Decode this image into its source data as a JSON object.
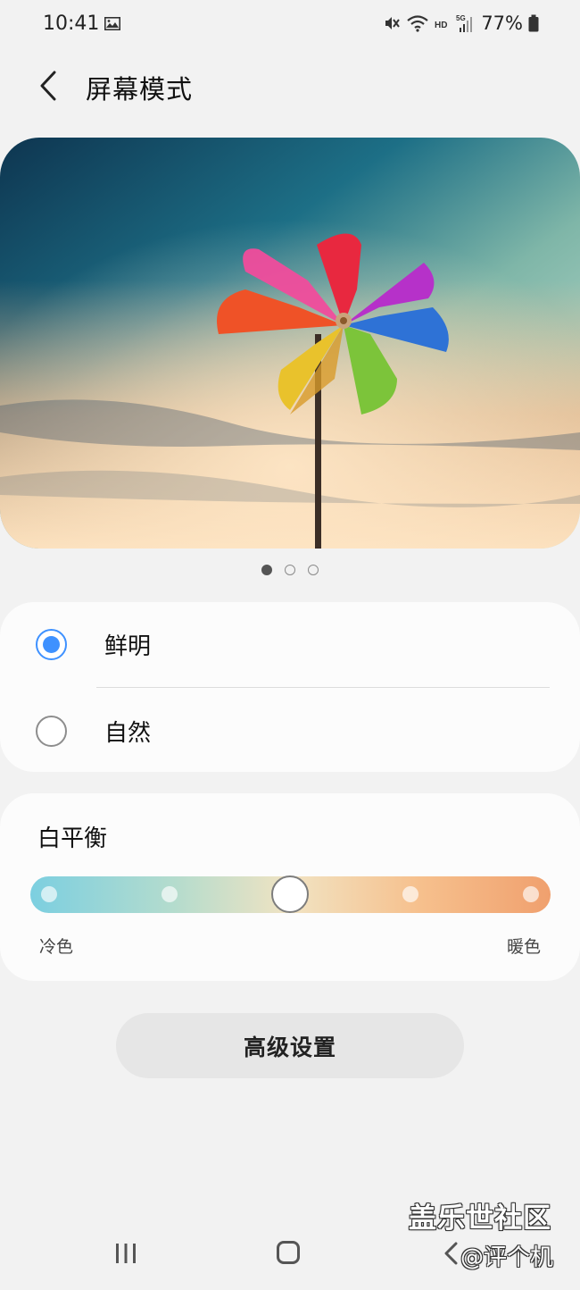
{
  "status_bar": {
    "time": "10:41",
    "battery_percent": "77%",
    "icons": [
      "gallery-icon",
      "mute-vibrate-icon",
      "wifi-icon",
      "hd-icon",
      "5g-signal-icon",
      "battery-icon"
    ]
  },
  "header": {
    "title": "屏幕模式",
    "back_icon": "chevron-left-icon"
  },
  "preview": {
    "image_subject": "pinwheel",
    "page_count": 3,
    "active_page": 1
  },
  "screen_mode": {
    "options": [
      {
        "label": "鲜明",
        "selected": true
      },
      {
        "label": "自然",
        "selected": false
      }
    ],
    "accent_color": "#3e91ff"
  },
  "white_balance": {
    "title": "白平衡",
    "cool_label": "冷色",
    "warm_label": "暖色",
    "steps": 5,
    "current_step": 3
  },
  "advanced_button": "高级设置",
  "watermark": {
    "main": "盖乐世社区",
    "sub": "@评个机"
  }
}
